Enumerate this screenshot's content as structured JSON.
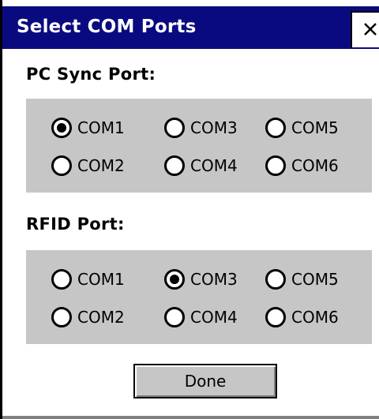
{
  "window": {
    "title": "Select COM Ports",
    "close_label": "×"
  },
  "pc_sync": {
    "label": "PC Sync Port:",
    "options": [
      "COM1",
      "COM3",
      "COM5",
      "COM2",
      "COM4",
      "COM6"
    ],
    "selected": "COM1"
  },
  "rfid": {
    "label": "RFID Port:",
    "options": [
      "COM1",
      "COM3",
      "COM5",
      "COM2",
      "COM4",
      "COM6"
    ],
    "selected": "COM3"
  },
  "footer": {
    "done_label": "Done"
  },
  "colors": {
    "titlebar": "#0a0a80",
    "group_bg": "#c6c6c6"
  }
}
